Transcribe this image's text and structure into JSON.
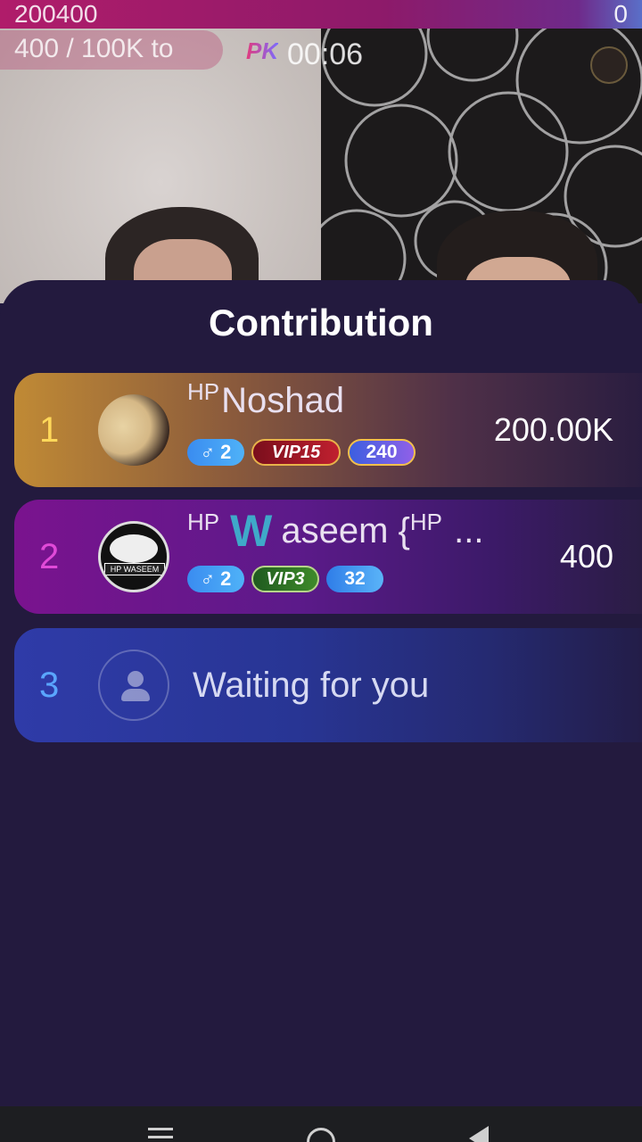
{
  "stream": {
    "score_left": "200400",
    "score_right": "0",
    "progress_label": "400 / 100K to",
    "pk_label": "PK",
    "pk_timer": "00:06"
  },
  "sheet": {
    "title": "Contribution"
  },
  "rows": [
    {
      "rank": "1",
      "name_prefix": "HP",
      "name": "Noshad",
      "gender_badge": "♂ 2",
      "vip_badge": "VIP15",
      "level_badge": "240",
      "score": "200.00K"
    },
    {
      "rank": "2",
      "name_prefix": "HP",
      "name_initial": "W",
      "name": "aseem {",
      "name_suffix_sup": "HP",
      "name_ellipsis": " ...",
      "avatar_label": "HP WASEEM",
      "gender_badge": "♂ 2",
      "vip_badge": "VIP3",
      "level_badge": "32",
      "score": "400"
    },
    {
      "rank": "3",
      "waiting_label": "Waiting for you"
    }
  ],
  "colors": {
    "background": "#231a3e",
    "rank1": "#ffd85a",
    "rank2": "#e04ad8",
    "rank3": "#5aa6ff"
  },
  "icons": {
    "placeholder_avatar": "person-icon",
    "nav_menu": "menu-icon",
    "nav_home": "home-icon",
    "nav_back": "back-icon"
  }
}
